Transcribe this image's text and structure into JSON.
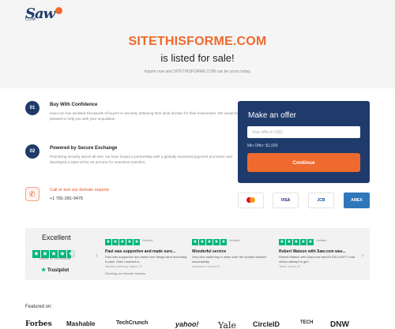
{
  "logo": {
    "mark": "Saw",
    "sub": "COM"
  },
  "hero": {
    "domain": "SITETHISFORME.COM",
    "listed": "is listed for sale!",
    "inquire": "Inquire now and SITETHISFORME.COM can be yours today."
  },
  "features": [
    {
      "num": "01",
      "title": "Buy With Confidence",
      "text": "Saw.com has assisted thousands of buyers in securely obtaining their ideal domain for their businesses. We would be pleased to help you with your acquisition."
    },
    {
      "num": "02",
      "title": "Powered by Secure Exchange",
      "text": "Prioritizing security above all else, we have forged a partnership with a globally renowned payment processor and developed a state-of-the-art process for seamless transfers."
    }
  ],
  "contact": {
    "talk": "Call or text our domain experts",
    "number": "+1 781-281-9475"
  },
  "offer": {
    "title": "Make an offer",
    "placeholder": "Your offer in USD",
    "min_offer": "Min Offer: $1,000",
    "button": "Continue"
  },
  "payments": [
    {
      "name": "mastercard-icon",
      "label": ""
    },
    {
      "name": "visa-icon",
      "label": "VISA"
    },
    {
      "name": "jcb-icon",
      "label": "JCB"
    },
    {
      "name": "amex-icon",
      "label": "AMEX"
    }
  ],
  "trustpilot": {
    "rating_word": "Excellent",
    "stars": 4.5,
    "based_on": "Based on 135 reviews",
    "brand": "Trustpilot",
    "showing": "Showing our favorite reviews",
    "verified": "Verified",
    "reviews": [
      {
        "title": "Paul was supportive and made sure...",
        "body": "Paul was supportive and made sure things went according to plan. Glad I worked w...",
        "author": "Muhitdin Bekmoy, March 21"
      },
      {
        "title": "Wonderful service",
        "body": "Very nice trasfering to make sure the domain transfer successfully.",
        "author": "yusheleon, March 22"
      },
      {
        "title": "Robert Watson with Saw.com was...",
        "body": "Robert Watson with Saw.com was EXCELLENT! I had others attempt to get...",
        "author": "Terek, March 22"
      }
    ]
  },
  "featured": {
    "label": "Featured on:",
    "outlets": [
      "Forbes",
      "Mashable",
      "TechCrunch",
      "yahoo!",
      "Yale",
      "CircleID",
      "TECH",
      "DNW"
    ]
  },
  "colors": {
    "accent": "#ef6a2e",
    "navy": "#1f3b6b",
    "trustpilot_green": "#00b67a"
  }
}
